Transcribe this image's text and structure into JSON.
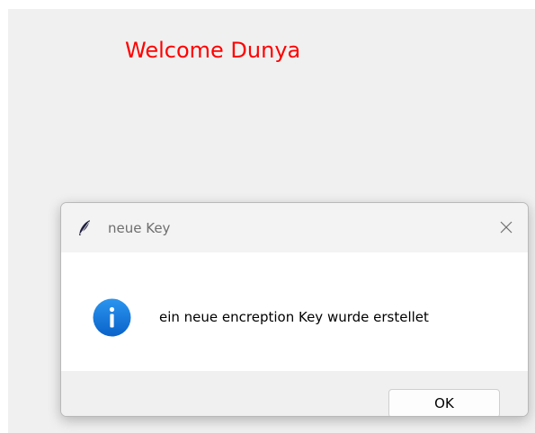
{
  "main_window": {
    "welcome_text": "Welcome Dunya",
    "welcome_color": "#ff0000"
  },
  "dialog": {
    "title": "neue Key",
    "title_icon": "feather-icon",
    "close_icon": "close-icon",
    "message_icon": "info-icon",
    "message": "ein neue encreption Key wurde erstellet",
    "ok_label": "OK",
    "info_icon_color": "#0a74d9"
  }
}
